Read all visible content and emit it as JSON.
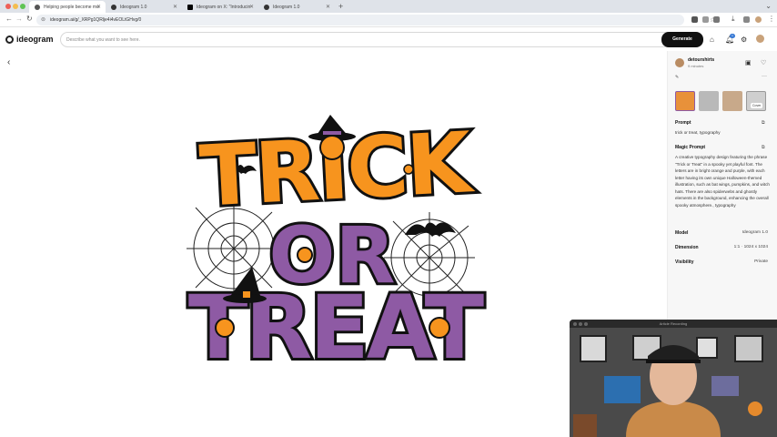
{
  "browser": {
    "tabs": [
      {
        "label": "Helping people become mo"
      },
      {
        "label": "Ideogram 1.0"
      },
      {
        "label": "Ideogram on X: \"Introducin"
      },
      {
        "label": "Ideogram 1.0"
      }
    ],
    "new_tab_symbol": "+",
    "url": "ideogram.ai/g/_XRPg1QRlje4i4vEOLtGHvg/0"
  },
  "app": {
    "logo_text": "ideogram",
    "prompt_placeholder": "Describe what you want to see here.",
    "generate_label": "Generate",
    "notification_count": "1"
  },
  "artwork": {
    "line1": "TRICK",
    "line2": "OR",
    "line3": "TREAT",
    "colors": {
      "orange": "#f7941e",
      "purple": "#8e5aa4",
      "outline": "#111111"
    }
  },
  "details": {
    "username": "detourshirts",
    "time": "9 minutes",
    "cover_label": "Cover",
    "prompt_heading": "Prompt",
    "prompt_text": "trick or treat, typography",
    "magic_heading": "Magic Prompt",
    "magic_text": "A creative typography design featuring the phrase \"Trick or Treat\" in a spooky yet playful font. The letters are in bright orange and purple, with each letter having its own unique Halloween-themed illustration, such as bat wings, pumpkins, and witch hats. There are also spiderwebs and ghostly elements in the background, enhancing the overall spooky atmosphere., typography",
    "model_label": "Model",
    "model_value": "Ideogram 1.0",
    "dimension_label": "Dimension",
    "dimension_value": "1:1 · 1024 x 1024",
    "visibility_label": "Visibility",
    "visibility_value": "Private"
  },
  "video_overlay": {
    "title": "Article Recording"
  }
}
